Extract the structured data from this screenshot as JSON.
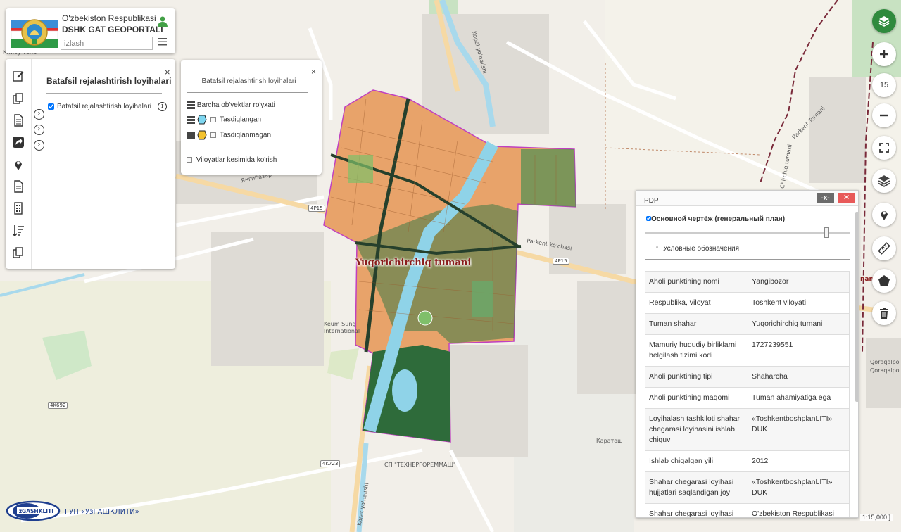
{
  "header": {
    "title_line1": "O'zbekiston Respublikasi",
    "title_line2": "DSHK GAT GEOPORTALI",
    "search_placeholder": "izlash"
  },
  "map": {
    "district_label": "Yuqorichirchiq tumani",
    "labels": {
      "top_left": "Кийоу тепа",
      "town_left": "Янгибазар",
      "school": "Keum Sung International",
      "enterprise": "СП \"ТЕХНЕРГОРЕММАШ\"",
      "karatash": "Каратош",
      "parkent_street": "Parkent ko'chasi",
      "parkent_tumani": "Parkent Tumani",
      "river_top": "Kopal yo'nalishi",
      "river_bottom": "Korat yo'nalishi",
      "qoraqalpoq_1": "Qoraqalpo",
      "qoraqalpoq_2": "Qoraqalpo",
      "chirchiq_tumani": "Chirchiq tumani",
      "far_right_red": "nan"
    },
    "road_shields": [
      "4P15",
      "4P15",
      "4K692",
      "4K723",
      "4P15"
    ],
    "scale_text": "1:15,000 ]"
  },
  "left_panel": {
    "title": "Batafsil rejalashtirish loyihalari",
    "layer_label": "Batafsil rejalashtirish loyihalari",
    "layer_checked": true,
    "close": "×"
  },
  "legend_panel": {
    "title": "Batafsil rejalashtirish loyihalari",
    "close": "×",
    "all_objects": "Barcha ob'yektlar ro'yxati",
    "approved": "Tasdiqlangan",
    "not_approved": "Tasdiqlanmagan",
    "by_region": "Viloyatlar kesimida ko'rish"
  },
  "right_toolbar": {
    "zoom_level": "15"
  },
  "pdp": {
    "title": "PDP",
    "minimize": "-x-",
    "close": "✕",
    "layer_label": "Основной чертёж (генеральный план)",
    "legend_link": "Условные обозначения",
    "rows": [
      {
        "key": "Aholi punktining nomi",
        "value": "Yangibozor"
      },
      {
        "key": "Respublika, viloyat",
        "value": "Toshkent viloyati"
      },
      {
        "key": "Tuman shahar",
        "value": "Yuqorichirchiq tumani"
      },
      {
        "key": "Mamuriy hududiy birliklarni belgilash tizimi kodi",
        "value": "1727239551"
      },
      {
        "key": "Aholi punktining tipi",
        "value": "Shaharcha"
      },
      {
        "key": "Aholi punktining maqomi",
        "value": "Tuman ahamiyatiga ega"
      },
      {
        "key": "Loyihalash tashkiloti shahar chegarasi loyihasini ishlab chiquv",
        "value": "«ToshkentboshplanLITI» DUK"
      },
      {
        "key": "Ishlab chiqalgan yili",
        "value": "2012"
      },
      {
        "key": "Shahar chegarasi loyihasi hujjatlari saqlandigan joy",
        "value": "«ToshkentboshplanLITI» DUK"
      },
      {
        "key": "Shahar chegarasi loyihasi",
        "value": "O'zbekiston Respublikasi"
      }
    ]
  },
  "footer": {
    "logo_text": "O'zGASHKLITI",
    "org_name": "ГУП «УзГАШКЛИТИ»"
  },
  "colors": {
    "accent_green": "#2f8a3d",
    "close_red": "#e85a5a",
    "district_border": "#c040c0",
    "residential_orange": "#e8a36a",
    "park_green": "#2e6b3a",
    "river_blue": "#8fd3e8"
  }
}
